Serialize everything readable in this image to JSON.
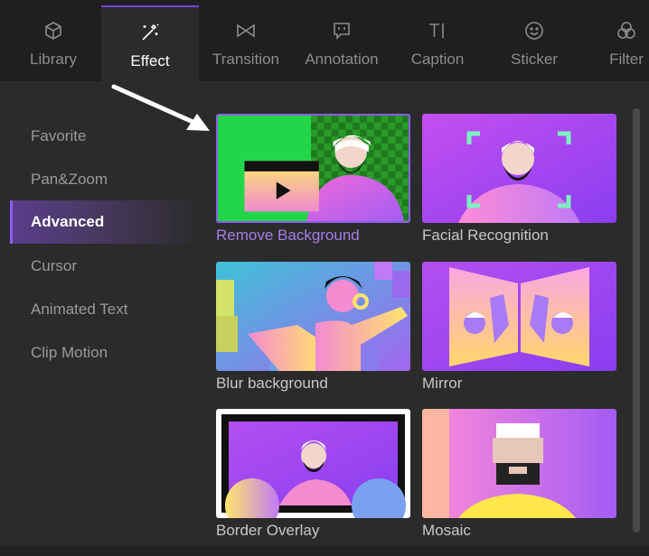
{
  "tabs": [
    {
      "label": "Library",
      "icon": "cube-icon"
    },
    {
      "label": "Effect",
      "icon": "magic-wand-icon",
      "active": true
    },
    {
      "label": "Transition",
      "icon": "transition-bowtie-icon"
    },
    {
      "label": "Annotation",
      "icon": "speech-bubble-icon"
    },
    {
      "label": "Caption",
      "icon": "text-caption-icon"
    },
    {
      "label": "Sticker",
      "icon": "smiley-icon"
    },
    {
      "label": "Filter",
      "icon": "filter-circles-icon"
    }
  ],
  "sidebar": {
    "items": [
      {
        "label": "Favorite"
      },
      {
        "label": "Pan&Zoom"
      },
      {
        "label": "Advanced",
        "active": true
      },
      {
        "label": "Cursor"
      },
      {
        "label": "Animated Text"
      },
      {
        "label": "Clip Motion"
      }
    ]
  },
  "effects": [
    {
      "label": "Remove Background",
      "selected": true
    },
    {
      "label": "Facial Recognition"
    },
    {
      "label": "Blur background"
    },
    {
      "label": "Mirror"
    },
    {
      "label": "Border Overlay"
    },
    {
      "label": "Mosaic"
    }
  ],
  "colors": {
    "accent": "#8e5cf0",
    "active_label": "#a77de8",
    "topbar_bg": "#1f1f1f",
    "panel_bg": "#2b2b2b"
  }
}
